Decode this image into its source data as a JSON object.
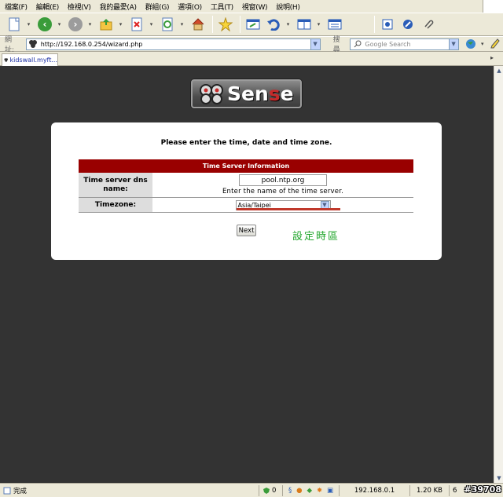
{
  "menu": [
    "檔案(F)",
    "編輯(E)",
    "檢視(V)",
    "我的最愛(A)",
    "群組(G)",
    "選項(O)",
    "工具(T)",
    "視窗(W)",
    "說明(H)"
  ],
  "address": {
    "label": "網址:",
    "url": "http://192.168.0.254/wizard.php"
  },
  "search": {
    "label": "搜尋",
    "placeholder": "Google Search"
  },
  "tab": {
    "title": "kidswall.myft..."
  },
  "logo": {
    "word_start": "Sen",
    "word_red": "s",
    "word_end": "e"
  },
  "page": {
    "heading": "Please enter the time, date and time zone.",
    "section_title": "Time Server Information",
    "time_server_label": "Time server dns name:",
    "time_server_value": "pool.ntp.org",
    "time_server_hint": "Enter the name of the time server.",
    "timezone_label": "Timezone:",
    "timezone_value": "Asia/Taipei",
    "next_label": "Next",
    "annotation": "設定時區"
  },
  "status": {
    "text": "完成",
    "count": "0",
    "ip": "192.168.0.1",
    "size": "1.20 KB",
    "extra": "6"
  },
  "watermark": "#39708",
  "colors": {
    "content_bg": "#333333",
    "table_header": "#990000",
    "annotation": "#1fa52a",
    "underline": "#c0392b"
  }
}
